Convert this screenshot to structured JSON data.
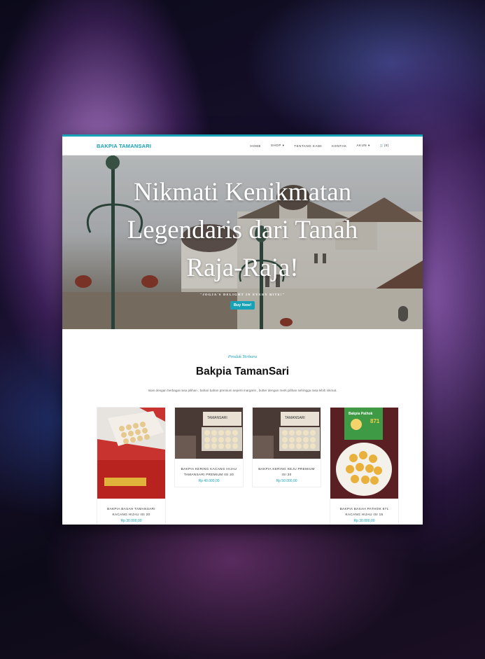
{
  "header": {
    "brand": "BAKPIA TAMANSARI",
    "menu": [
      "HOME",
      "SHOP ▾",
      "TENTANG KAMI",
      "KONTAK",
      "AKUN ▾",
      "🛒(0)"
    ]
  },
  "hero": {
    "title": "Nikmati Kenikmatan Legendaris dari Tanah Raja-Raja!",
    "tagline": "\"JOGJA'S DELIGHT IN EVERY BITE!\"",
    "button": "Buy Now!"
  },
  "section": {
    "eyebrow": "Produk Terbaru",
    "heading": "Bakpia TamanSari",
    "description": "Isian dengan berbagai rasa pilihan , bahan bahan premium seperti margarin , butter dengan merk pilihan sehingga rasa lebih nikmat."
  },
  "products": [
    {
      "name": "BAKPIA BASAH TAMANSARI KACANG HIJAU ISI 20",
      "price": "Rp 30.000,00"
    },
    {
      "name": "BAKPIA KERING KACANG HIJAU TAMANSARI PREMIUM ISI 20",
      "price": "Rp 40.000,00"
    },
    {
      "name": "BAKPIA KERING KEJU PREMIUM ISI 20",
      "price": "Rp 50.000,00"
    },
    {
      "name": "BAKPIA BASAH PATHOK 871 KACANG HIJAU ISI 15",
      "price": "Rp 30.000,00"
    }
  ],
  "box_labels": {
    "box_brand": "TAMANSARI",
    "box_brand_b": "TAMANSARI",
    "box3_top": "Bakpia Pathok",
    "box3_num": "871"
  },
  "colors": {
    "accent": "#17a2b8"
  }
}
